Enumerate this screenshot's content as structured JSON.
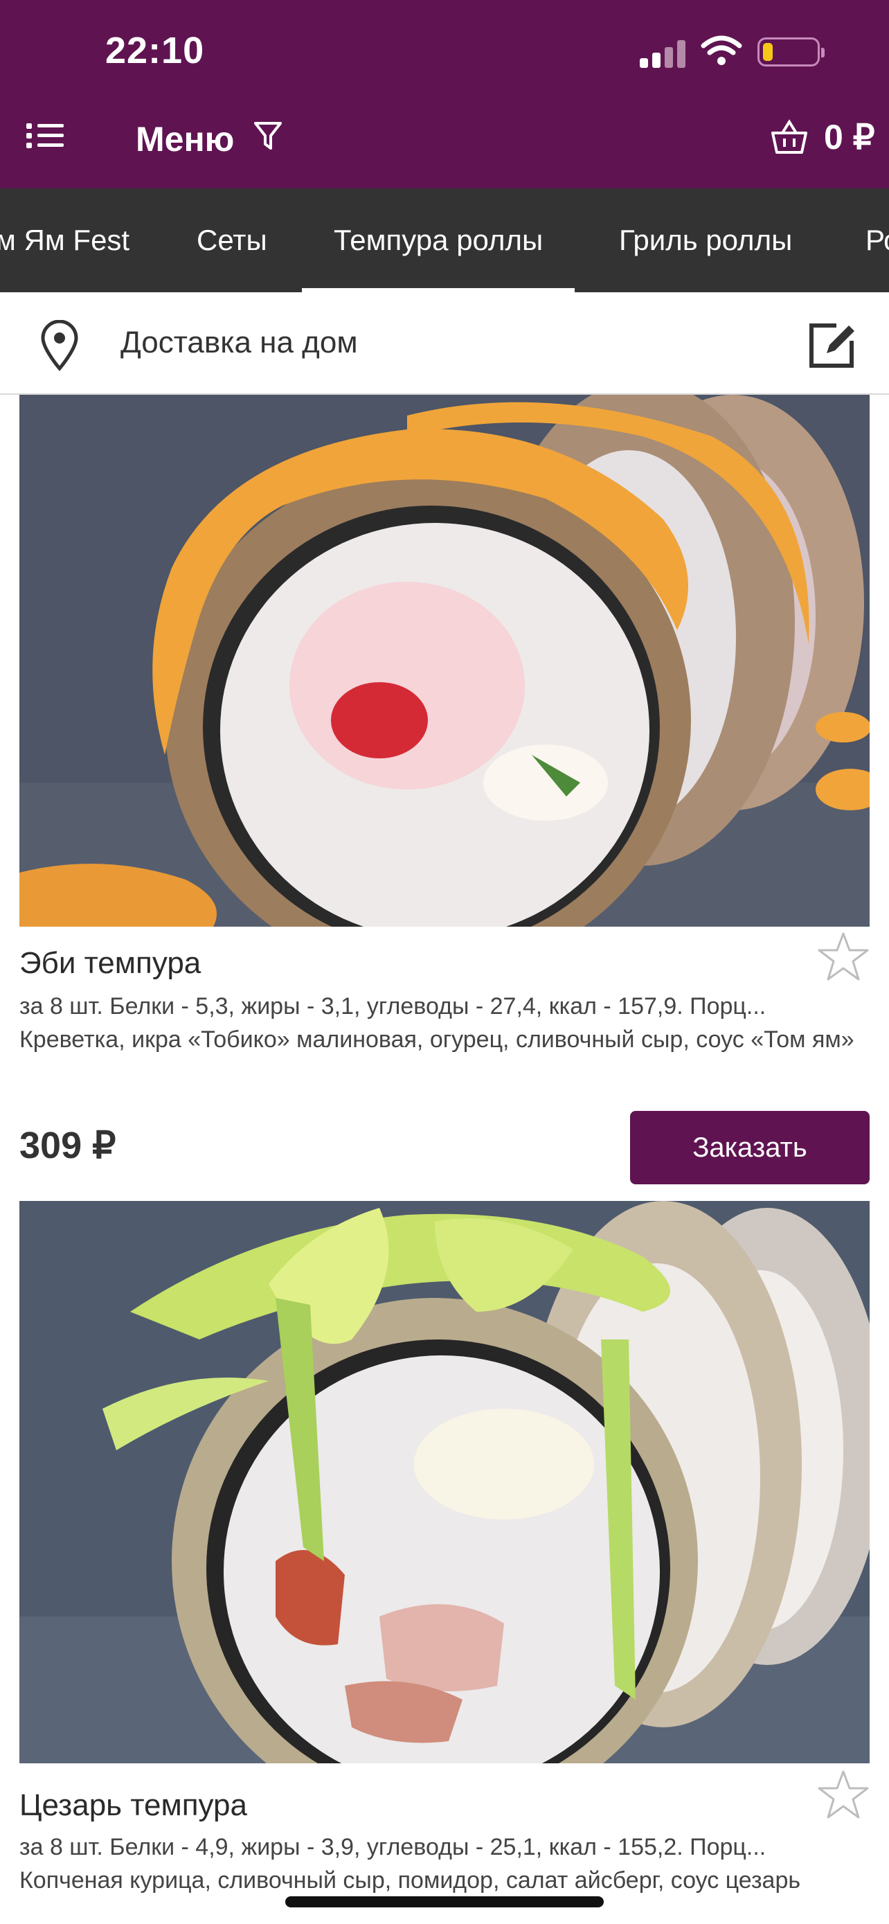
{
  "status_bar": {
    "time": "22:10",
    "colors": {
      "bar_active": "#ffffff",
      "bar_inactive": "#b58aa8",
      "battery_fill": "#f5c818"
    }
  },
  "header": {
    "title": "Меню",
    "cart_amount": "0 ₽",
    "background": "#5f1451",
    "icons": {
      "menu": "list-menu-icon",
      "filter": "filter-icon",
      "cart": "basket-icon"
    }
  },
  "tabs": {
    "items": [
      {
        "label": "м Ям Fest"
      },
      {
        "label": "Сеты"
      },
      {
        "label": "Темпура роллы"
      },
      {
        "label": "Гриль роллы"
      },
      {
        "label": "Ро"
      }
    ],
    "active_index": 2,
    "background": "#333333"
  },
  "delivery": {
    "label": "Доставка на дом",
    "icons": {
      "location": "map-pin-icon",
      "edit": "edit-square-icon"
    }
  },
  "products": [
    {
      "name": "Эби темпура",
      "nutrition": "за 8 шт. Белки - 5,3, жиры - 3,1, углеводы - 27,4, ккал - 157,9. Порц...",
      "description": "Креветка, икра «Тобико» малиновая, огурец, сливочный сыр, соус «Том ям»",
      "price": "309 ₽",
      "order_label": "Заказать",
      "favorite": false
    },
    {
      "name": "Цезарь темпура",
      "nutrition": "за 8 шт. Белки - 4,9, жиры - 3,9, углеводы - 25,1, ккал - 155,2. Порц...",
      "description": "Копченая курица, сливочный сыр, помидор, салат айсберг, соус цезарь",
      "favorite": false
    }
  ],
  "accent_color": "#5f1451"
}
